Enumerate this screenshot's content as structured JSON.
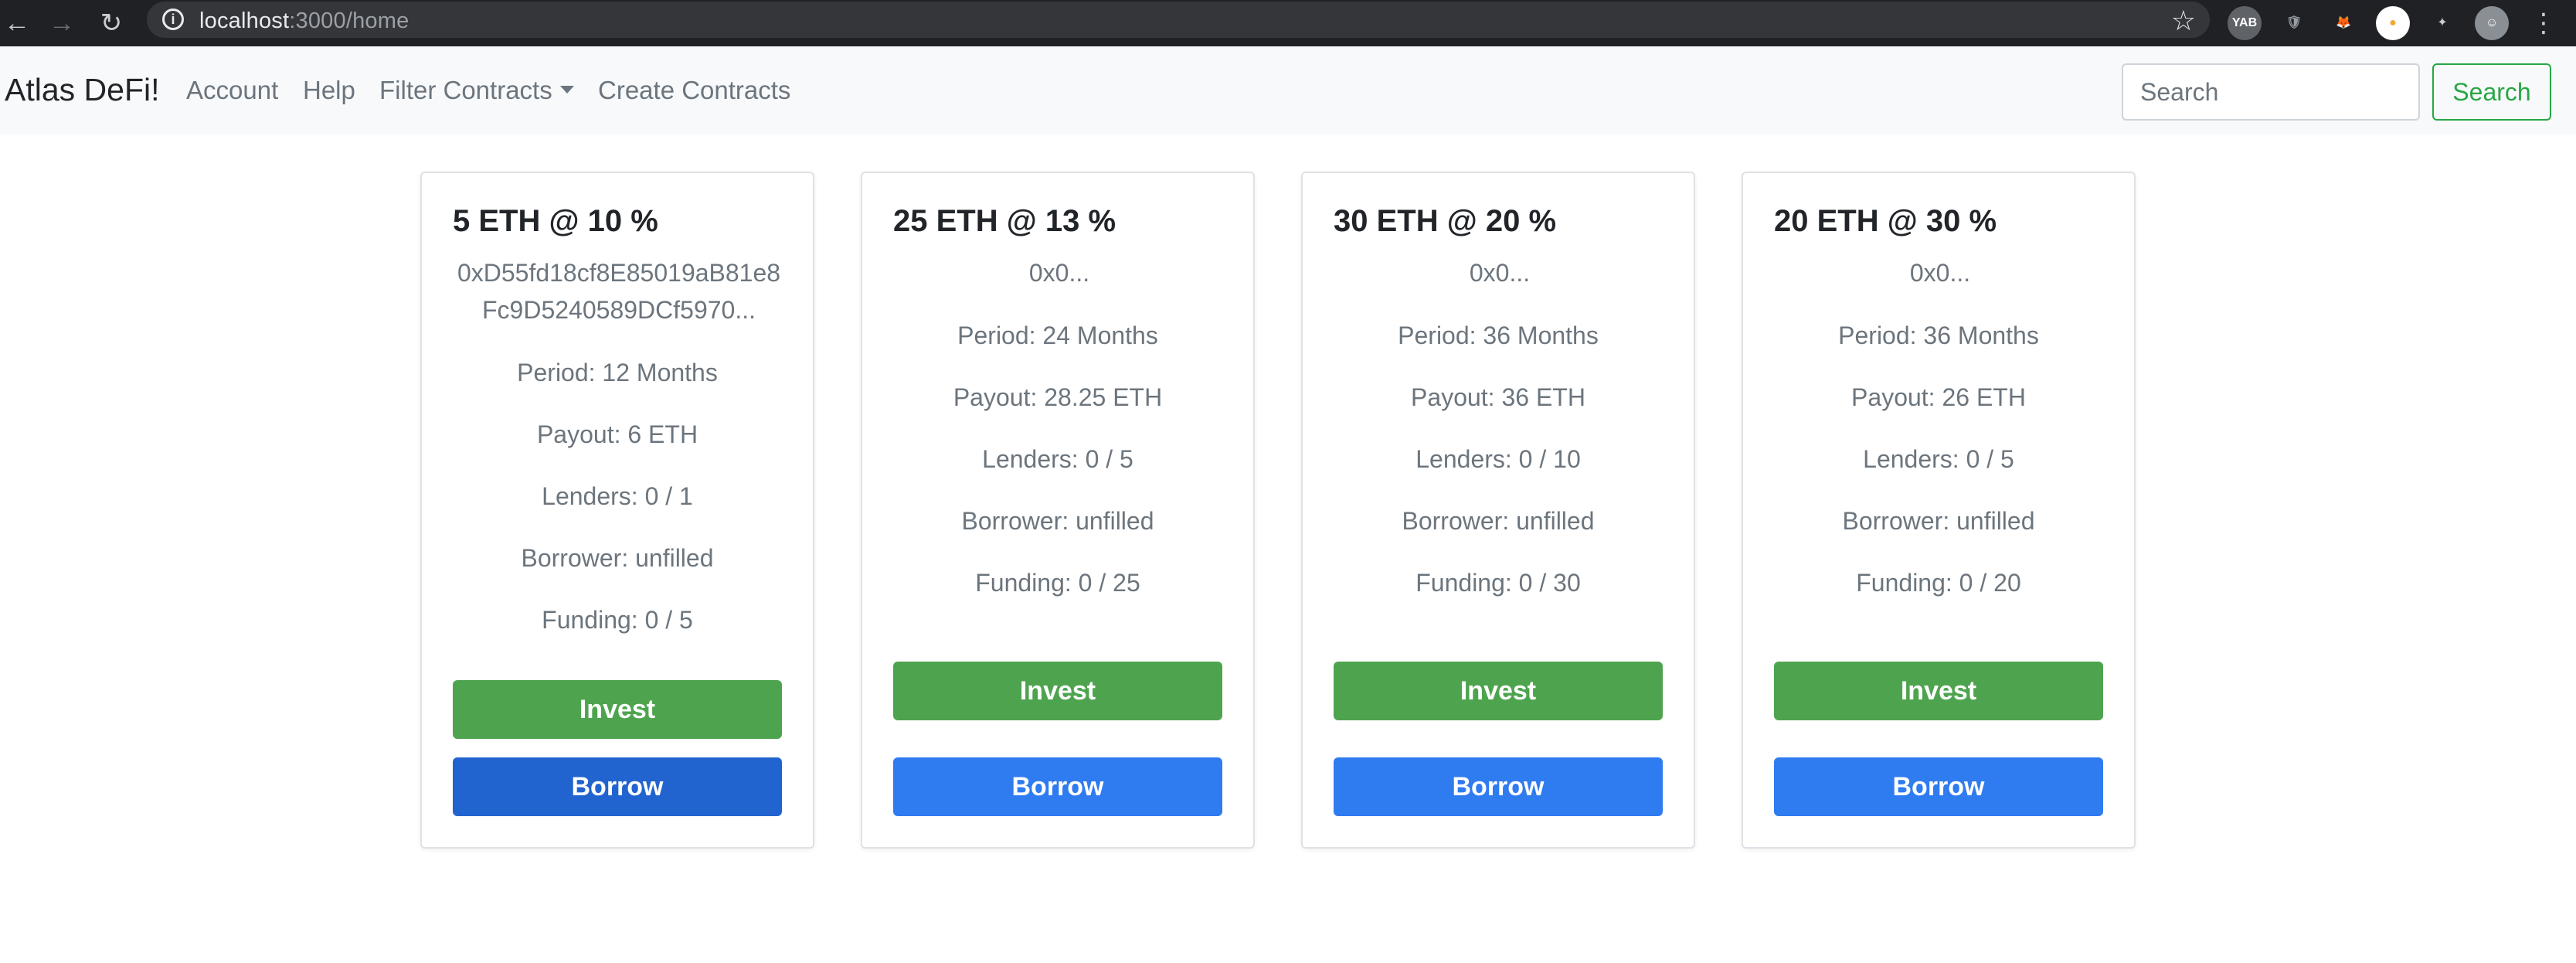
{
  "browser": {
    "url_host": "localhost",
    "url_path": ":3000/home",
    "extensions": [
      {
        "name": "yab-extension-icon",
        "label": "YAB",
        "bg": "#5f6368",
        "fg": "#ffffff"
      },
      {
        "name": "shield-extension-icon",
        "label": "🛡",
        "bg": "#202124",
        "fg": "#9aa0a6"
      },
      {
        "name": "metamask-fox-icon",
        "label": "🦊",
        "bg": "#202124",
        "fg": "#e2761b"
      },
      {
        "name": "wallet-extension-icon",
        "label": "●",
        "bg": "#ffffff",
        "fg": "#f0a830"
      },
      {
        "name": "puzzle-extensions-icon",
        "label": "✦",
        "bg": "#202124",
        "fg": "#c9cdd2"
      },
      {
        "name": "profile-avatar",
        "label": "☺",
        "bg": "#8a8f96",
        "fg": "#ffffff"
      }
    ]
  },
  "navbar": {
    "brand": "Atlas DeFi!",
    "links": [
      "Account",
      "Help",
      "Filter Contracts",
      "Create Contracts"
    ],
    "search_placeholder": "Search",
    "search_button": "Search"
  },
  "colors": {
    "invest": "#4ea44e",
    "borrow": "#2f7bf0",
    "borrow_active": "#2264cf",
    "search_outline": "#28a745"
  },
  "cards": [
    {
      "title": "5 ETH @ 10 %",
      "address": "0xD55fd18cf8E85019aB81e8Fc9D5240589DCf5970...",
      "period": "Period: 12 Months",
      "payout": "Payout: 6 ETH",
      "lenders": "Lenders: 0 / 1",
      "borrower": "Borrower: unfilled",
      "funding": "Funding: 0 / 5",
      "invest_label": "Invest",
      "borrow_label": "Borrow"
    },
    {
      "title": "25 ETH @ 13 %",
      "address": "0x0...",
      "period": "Period: 24 Months",
      "payout": "Payout: 28.25 ETH",
      "lenders": "Lenders: 0 / 5",
      "borrower": "Borrower: unfilled",
      "funding": "Funding: 0 / 25",
      "invest_label": "Invest",
      "borrow_label": "Borrow"
    },
    {
      "title": "30 ETH @ 20 %",
      "address": "0x0...",
      "period": "Period: 36 Months",
      "payout": "Payout: 36 ETH",
      "lenders": "Lenders: 0 / 10",
      "borrower": "Borrower: unfilled",
      "funding": "Funding: 0 / 30",
      "invest_label": "Invest",
      "borrow_label": "Borrow"
    },
    {
      "title": "20 ETH @ 30 %",
      "address": "0x0...",
      "period": "Period: 36 Months",
      "payout": "Payout: 26 ETH",
      "lenders": "Lenders: 0 / 5",
      "borrower": "Borrower: unfilled",
      "funding": "Funding: 0 / 20",
      "invest_label": "Invest",
      "borrow_label": "Borrow"
    }
  ]
}
